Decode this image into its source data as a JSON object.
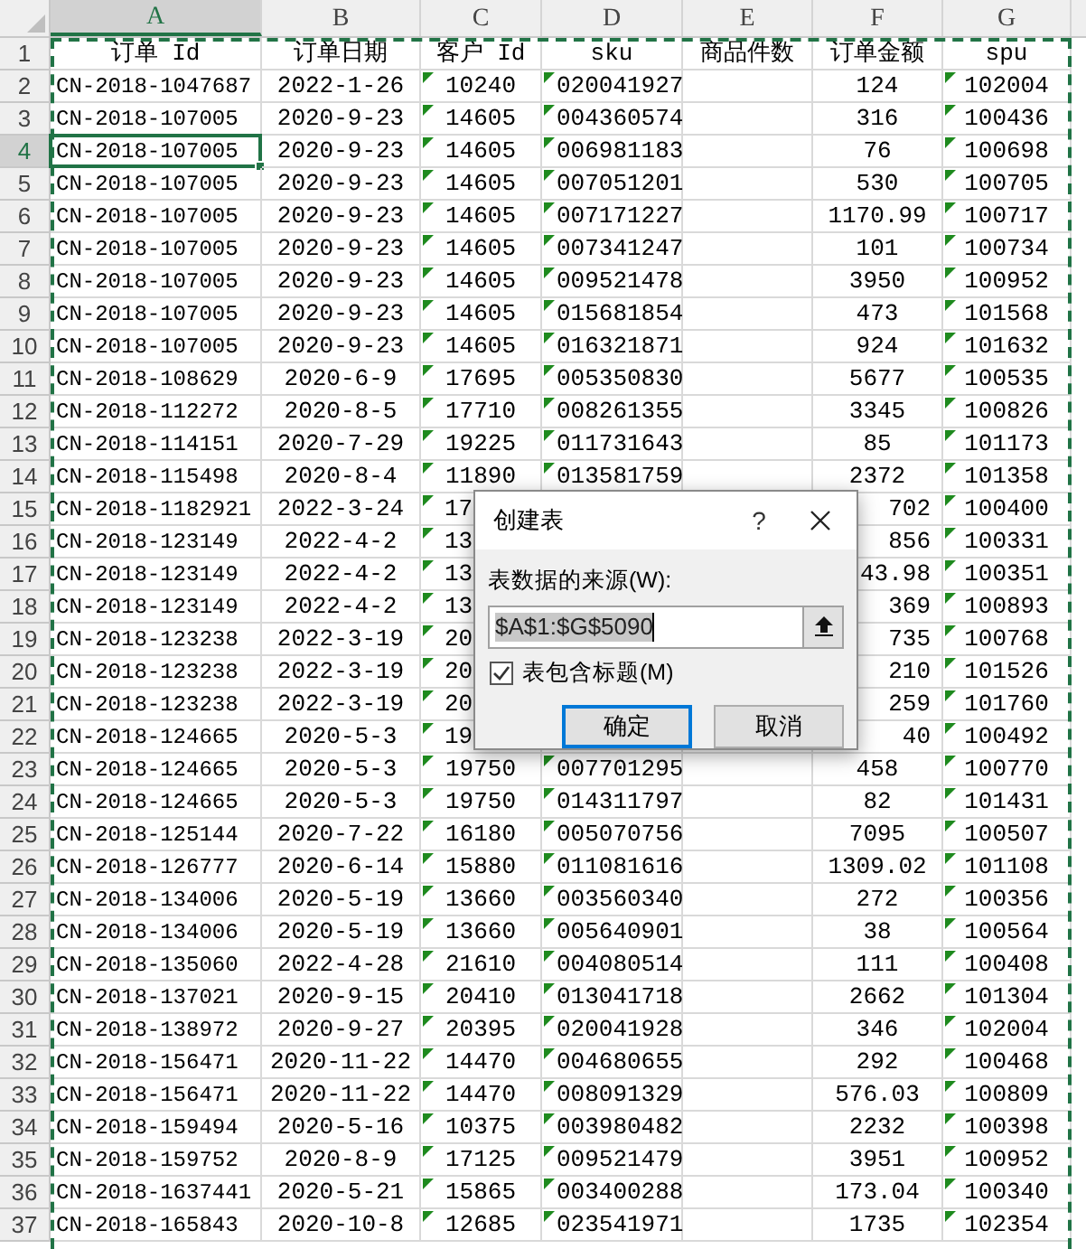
{
  "columns": [
    {
      "letter": "A",
      "selected": true,
      "flagged": false
    },
    {
      "letter": "B",
      "selected": false,
      "flagged": false
    },
    {
      "letter": "C",
      "selected": false,
      "flagged": true
    },
    {
      "letter": "D",
      "selected": false,
      "flagged": true
    },
    {
      "letter": "E",
      "selected": false,
      "flagged": false
    },
    {
      "letter": "F",
      "selected": false,
      "flagged": false
    },
    {
      "letter": "G",
      "selected": false,
      "flagged": true
    }
  ],
  "rows": [
    {
      "number": "1",
      "selected": false,
      "cells": [
        "订单 Id",
        "订单日期",
        "客户 Id",
        "sku",
        "商品件数",
        "订单金额",
        "spu"
      ]
    },
    {
      "number": "2",
      "selected": false,
      "cells": [
        "CN-2018-1047687",
        "2022-1-26",
        "10240",
        "020041927",
        null,
        "124",
        "102004"
      ]
    },
    {
      "number": "3",
      "selected": false,
      "cells": [
        "CN-2018-107005",
        "2020-9-23",
        "14605",
        "004360574",
        null,
        "316",
        "100436"
      ]
    },
    {
      "number": "4",
      "selected": true,
      "cells": [
        "CN-2018-107005",
        "2020-9-23",
        "14605",
        "006981183",
        null,
        "76",
        "100698"
      ]
    },
    {
      "number": "5",
      "selected": false,
      "cells": [
        "CN-2018-107005",
        "2020-9-23",
        "14605",
        "007051201",
        null,
        "530",
        "100705"
      ]
    },
    {
      "number": "6",
      "selected": false,
      "cells": [
        "CN-2018-107005",
        "2020-9-23",
        "14605",
        "007171227",
        null,
        "1170.99",
        "100717"
      ]
    },
    {
      "number": "7",
      "selected": false,
      "cells": [
        "CN-2018-107005",
        "2020-9-23",
        "14605",
        "007341247",
        null,
        "101",
        "100734"
      ]
    },
    {
      "number": "8",
      "selected": false,
      "cells": [
        "CN-2018-107005",
        "2020-9-23",
        "14605",
        "009521478",
        null,
        "3950",
        "100952"
      ]
    },
    {
      "number": "9",
      "selected": false,
      "cells": [
        "CN-2018-107005",
        "2020-9-23",
        "14605",
        "015681854",
        null,
        "473",
        "101568"
      ]
    },
    {
      "number": "10",
      "selected": false,
      "cells": [
        "CN-2018-107005",
        "2020-9-23",
        "14605",
        "016321871",
        null,
        "924",
        "101632"
      ]
    },
    {
      "number": "11",
      "selected": false,
      "cells": [
        "CN-2018-108629",
        "2020-6-9",
        "17695",
        "005350830",
        null,
        "5677",
        "100535"
      ]
    },
    {
      "number": "12",
      "selected": false,
      "cells": [
        "CN-2018-112272",
        "2020-8-5",
        "17710",
        "008261355",
        null,
        "3345",
        "100826"
      ]
    },
    {
      "number": "13",
      "selected": false,
      "cells": [
        "CN-2018-114151",
        "2020-7-29",
        "19225",
        "011731643",
        null,
        "85",
        "101173"
      ]
    },
    {
      "number": "14",
      "selected": false,
      "cells": [
        "CN-2018-115498",
        "2020-8-4",
        "11890",
        "013581759",
        null,
        "2372",
        "101358"
      ]
    },
    {
      "number": "15",
      "selected": false,
      "cells": [
        "CN-2018-1182921",
        "2022-3-24",
        "17",
        null,
        null,
        "702",
        "100400"
      ]
    },
    {
      "number": "16",
      "selected": false,
      "cells": [
        "CN-2018-123149",
        "2022-4-2",
        "13",
        null,
        null,
        "856",
        "100331"
      ]
    },
    {
      "number": "17",
      "selected": false,
      "cells": [
        "CN-2018-123149",
        "2022-4-2",
        "13",
        null,
        null,
        "43.98",
        "100351"
      ]
    },
    {
      "number": "18",
      "selected": false,
      "cells": [
        "CN-2018-123149",
        "2022-4-2",
        "13",
        null,
        null,
        "369",
        "100893"
      ]
    },
    {
      "number": "19",
      "selected": false,
      "cells": [
        "CN-2018-123238",
        "2022-3-19",
        "20",
        null,
        null,
        "735",
        "100768"
      ]
    },
    {
      "number": "20",
      "selected": false,
      "cells": [
        "CN-2018-123238",
        "2022-3-19",
        "20",
        null,
        null,
        "210",
        "101526"
      ]
    },
    {
      "number": "21",
      "selected": false,
      "cells": [
        "CN-2018-123238",
        "2022-3-19",
        "20",
        null,
        null,
        "259",
        "101760"
      ]
    },
    {
      "number": "22",
      "selected": false,
      "cells": [
        "CN-2018-124665",
        "2020-5-3",
        "19",
        null,
        null,
        "40",
        "100492"
      ]
    },
    {
      "number": "23",
      "selected": false,
      "cells": [
        "CN-2018-124665",
        "2020-5-3",
        "19750",
        "007701295",
        null,
        "458",
        "100770"
      ]
    },
    {
      "number": "24",
      "selected": false,
      "cells": [
        "CN-2018-124665",
        "2020-5-3",
        "19750",
        "014311797",
        null,
        "82",
        "101431"
      ]
    },
    {
      "number": "25",
      "selected": false,
      "cells": [
        "CN-2018-125144",
        "2020-7-22",
        "16180",
        "005070756",
        null,
        "7095",
        "100507"
      ]
    },
    {
      "number": "26",
      "selected": false,
      "cells": [
        "CN-2018-126777",
        "2020-6-14",
        "15880",
        "011081616",
        null,
        "1309.02",
        "101108"
      ]
    },
    {
      "number": "27",
      "selected": false,
      "cells": [
        "CN-2018-134006",
        "2020-5-19",
        "13660",
        "003560340",
        null,
        "272",
        "100356"
      ]
    },
    {
      "number": "28",
      "selected": false,
      "cells": [
        "CN-2018-134006",
        "2020-5-19",
        "13660",
        "005640901",
        null,
        "38",
        "100564"
      ]
    },
    {
      "number": "29",
      "selected": false,
      "cells": [
        "CN-2018-135060",
        "2022-4-28",
        "21610",
        "004080514",
        null,
        "111",
        "100408"
      ]
    },
    {
      "number": "30",
      "selected": false,
      "cells": [
        "CN-2018-137021",
        "2020-9-15",
        "20410",
        "013041718",
        null,
        "2662",
        "101304"
      ]
    },
    {
      "number": "31",
      "selected": false,
      "cells": [
        "CN-2018-138972",
        "2020-9-27",
        "20395",
        "020041928",
        null,
        "346",
        "102004"
      ]
    },
    {
      "number": "32",
      "selected": false,
      "cells": [
        "CN-2018-156471",
        "2020-11-22",
        "14470",
        "004680655",
        null,
        "292",
        "100468"
      ]
    },
    {
      "number": "33",
      "selected": false,
      "cells": [
        "CN-2018-156471",
        "2020-11-22",
        "14470",
        "008091329",
        null,
        "576.03",
        "100809"
      ]
    },
    {
      "number": "34",
      "selected": false,
      "cells": [
        "CN-2018-159494",
        "2020-5-16",
        "10375",
        "003980482",
        null,
        "2232",
        "100398"
      ]
    },
    {
      "number": "35",
      "selected": false,
      "cells": [
        "CN-2018-159752",
        "2020-8-9",
        "17125",
        "009521479",
        null,
        "3951",
        "100952"
      ]
    },
    {
      "number": "36",
      "selected": false,
      "cells": [
        "CN-2018-1637441",
        "2020-5-21",
        "15865",
        "003400288",
        null,
        "173.04",
        "100340"
      ]
    },
    {
      "number": "37",
      "selected": false,
      "cells": [
        "CN-2018-165843",
        "2020-10-8",
        "12685",
        "023541971",
        null,
        "1735",
        "102354"
      ]
    }
  ],
  "dialog": {
    "title": "创建表",
    "help": "?",
    "source_label": "表数据的来源(W):",
    "source_value": "$A$1:$G$5090",
    "header_checkbox": {
      "label": "表包含标题(M)",
      "checked": true
    },
    "buttons": [
      {
        "label": "确定",
        "default": true
      },
      {
        "label": "取消",
        "default": false
      }
    ]
  }
}
